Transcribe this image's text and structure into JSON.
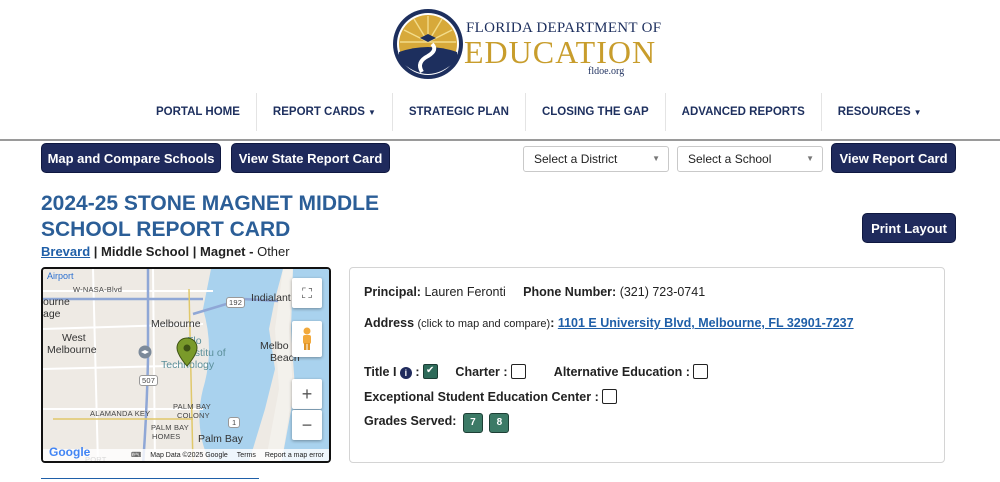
{
  "brand": {
    "line1": "FLORIDA DEPARTMENT OF",
    "line2": "EDUCATION",
    "line3": "fldoe.org"
  },
  "nav": [
    {
      "label": "PORTAL HOME",
      "dropdown": false
    },
    {
      "label": "REPORT CARDS",
      "dropdown": true
    },
    {
      "label": "STRATEGIC PLAN",
      "dropdown": false
    },
    {
      "label": "CLOSING THE GAP",
      "dropdown": false
    },
    {
      "label": "ADVANCED REPORTS",
      "dropdown": false
    },
    {
      "label": "RESOURCES",
      "dropdown": true
    }
  ],
  "toolbar": {
    "map_compare": "Map and Compare Schools",
    "state_report": "View State Report Card",
    "district_select": "Select a District",
    "school_select": "Select a School",
    "view_report": "View Report Card",
    "print_layout": "Print Layout"
  },
  "school": {
    "title": "2024-25 STONE MAGNET MIDDLE SCHOOL REPORT CARD",
    "district": "Brevard",
    "level": "Middle School",
    "type": "Magnet",
    "other": "Other",
    "sep": " | "
  },
  "map": {
    "labels": {
      "airport": "Airport",
      "nasa": "W-NASA-Blvd",
      "bourne": "ourne",
      "age": "age",
      "melbourne": "Melbourne",
      "west": "West",
      "west2": "Melbourne",
      "indialantic": "Indialant",
      "flinst": "Flo",
      "flinst2": "Institu  of",
      "flinst3": "Technology",
      "melbeach": "Melbo",
      "melbeach2": "Beach",
      "alamanda": "ALAMANDA KEY",
      "palmbaycolony": "PALM BAY",
      "palmbaycolony2": "COLONY",
      "pbhomes": "PALM BAY",
      "pbhomes2": "HOMES",
      "palmbay": "Palm Bay",
      "port": "PORT",
      "r192": "192",
      "r507": "507",
      "r1": "1"
    },
    "footer": {
      "google": "Google",
      "map_data": "Map Data ©2025 Google",
      "terms": "Terms",
      "report": "Report a map error"
    },
    "colors": {
      "water": "#a9d2ee",
      "land": "#eeeae4",
      "marker": "#7a9a2a"
    }
  },
  "info": {
    "principal_label": "Principal:",
    "principal": "Lauren Feronti",
    "phone_label": "Phone Number:",
    "phone": "(321) 723-0741",
    "address_label": "Address",
    "address_hint": "(click to map and compare)",
    "address_colon": ":",
    "address": "1101 E University Blvd, Melbourne, FL 32901-7237",
    "title1_label": "Title I",
    "title1_checked": true,
    "charter_label": "Charter :",
    "charter_checked": false,
    "alt_label": "Alternative Education :",
    "alt_checked": false,
    "ese_label": "Exceptional Student Education Center :",
    "ese_checked": false,
    "grades_label": "Grades Served:",
    "grades": [
      "7",
      "8"
    ]
  },
  "colors": {
    "navy": "#1f2a5c",
    "title_blue": "#2b5e97",
    "gold": "#c89d2c",
    "grade_green": "#3c7a66"
  }
}
